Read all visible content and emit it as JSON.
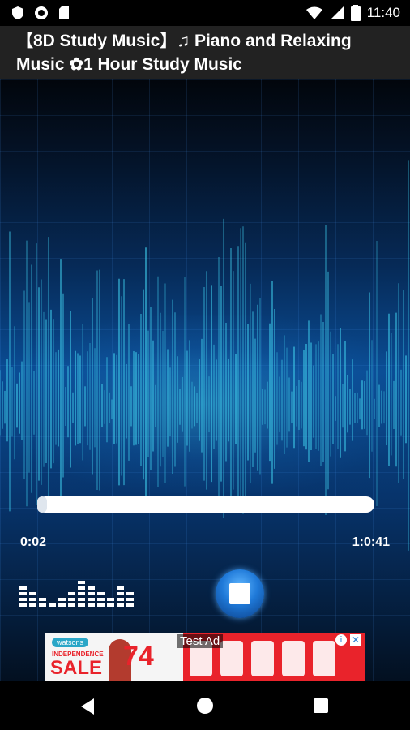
{
  "status_bar": {
    "time": "11:40",
    "icons": [
      "shield-icon",
      "record-icon",
      "sd-card-icon",
      "wifi-icon",
      "signal-icon",
      "battery-icon"
    ]
  },
  "title": "【8D Study Music】♫ Piano and Relaxing Music ✿1 Hour Study Music",
  "player": {
    "current_time": "0:02",
    "total_time": "1:0:41",
    "progress": 0.03,
    "stop_icon": "stop-icon",
    "equalizer_icon": "equalizer-icon"
  },
  "ad": {
    "label": "Test Ad",
    "brand": "watsons",
    "headline": "INDEPENDENCE",
    "sale": "SALE",
    "percent": "74",
    "close_icon": "close-icon",
    "info_icon": "info-icon"
  },
  "nav_bar": {
    "icons": [
      "back-icon",
      "home-icon",
      "recent-apps-icon"
    ]
  },
  "colors": {
    "background": "#000000",
    "title_bar": "#222222",
    "wave": "#3ec9e8",
    "ad_red": "#e9232b",
    "stop_button": "#1f79d8"
  }
}
